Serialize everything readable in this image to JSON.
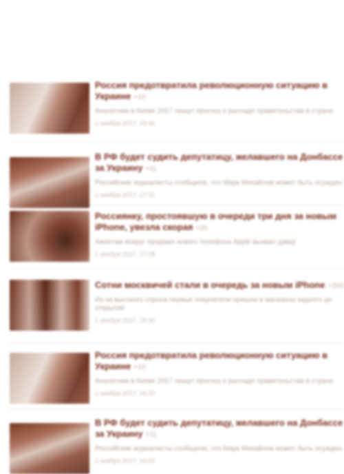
{
  "feed": {
    "items": [
      {
        "title": "Россия предотвратила революционную ситуацию в Украине",
        "badge": "+10",
        "description": "Аналитики в Киеве 2017 пишут прогноз о распаде правительства в стране",
        "date": "1 ноября 2017, 18:42",
        "thumb": "t-a",
        "icon": "news-thumbnail-image"
      },
      {
        "title": "В РФ будет судить депутатицу, желавшего на Донбассе за Украину",
        "badge": "+11",
        "description": "Российские журналисты сообщили, что Марк Михайлов может быть осужден",
        "date": "1 ноября 2017, 17:31",
        "thumb": "t-b",
        "icon": "news-thumbnail-image"
      },
      {
        "title": "Россиянку, простоявшую в очереди три дня за новым iPhone, увезла скорая",
        "badge": "+20",
        "description": "Ажиотаж вокруг продажи нового телефона Apple вызвал давку",
        "date": "1 ноября 2017, 17:28",
        "thumb": "t-c",
        "icon": "news-thumbnail-image"
      },
      {
        "title": "Сотни москвичей стали в очередь за новым iPhone",
        "badge": "+200",
        "description": "Из-за высокого спроса первые покупатели пришли в магазины задолго до открытия",
        "date": "1 ноября 2017, 16:30",
        "thumb": "t-d",
        "icon": "news-thumbnail-image"
      },
      {
        "title": "Россия предотвратила революционную ситуацию в Украине",
        "badge": "+10",
        "description": "Аналитики в Киеве 2017 пишут прогноз о распаде правительства в стране",
        "date": "1 ноября 2017, 16:20",
        "thumb": "t-a",
        "icon": "news-thumbnail-image"
      },
      {
        "title": "В РФ будет судить депутатицу, желавшего на Донбассе за Украину",
        "badge": "+11",
        "description": "Российские журналисты сообщили, что Марк Михайлов может быть осужден",
        "date": "1 ноября 2017, 16:03",
        "thumb": "t-b",
        "icon": "news-thumbnail-image"
      }
    ]
  }
}
